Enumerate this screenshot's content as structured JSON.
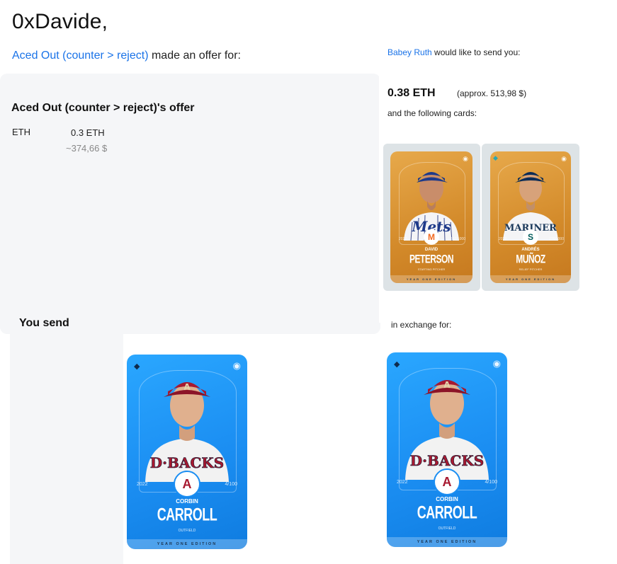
{
  "greeting": "0xDavide,",
  "offer_line": {
    "user": "Aced Out (counter > reject)",
    "text": " made an offer for:"
  },
  "left_panel": {
    "title": "Aced Out (counter > reject)'s offer",
    "currency_label": "ETH",
    "amount": "0.3 ETH",
    "approx_usd": "~374,66 $"
  },
  "you_send_label": "You send",
  "right": {
    "user": "Babey Ruth",
    "intro_text": " would like to send you:",
    "eth": "0.38 ETH",
    "approx": "(approx. 513,98 $)",
    "following": "and the following cards:",
    "exchange_label": "in exchange for:"
  },
  "cards": {
    "peterson": {
      "first": "DAVID",
      "last": "PETERSON",
      "position": "STARTING PITCHER",
      "year": "2022",
      "serial": "557/1000",
      "edition": "YEAR ONE EDITION",
      "team_logo": "M"
    },
    "munoz": {
      "first": "ANDRÉS",
      "last": "MUÑOZ",
      "position": "RELIEF PITCHER",
      "year": "2022",
      "serial": "276/1000",
      "edition": "YEAR ONE EDITION",
      "team_logo": "S"
    },
    "carroll": {
      "first": "CORBIN",
      "last": "CARROLL",
      "position": "OUTFIELD",
      "year": "2022",
      "serial": "4/100",
      "edition": "YEAR ONE EDITION",
      "team_logo": "A",
      "jersey": "D·BACKS"
    }
  },
  "colors": {
    "link": "#1a73e8",
    "panel_bg": "#f5f6f8",
    "gold_card": "#d38a2a",
    "blue_card": "#1b8ef2"
  },
  "icons": [
    "sorare-logo-icon",
    "target-icon",
    "team-logo-icon"
  ]
}
